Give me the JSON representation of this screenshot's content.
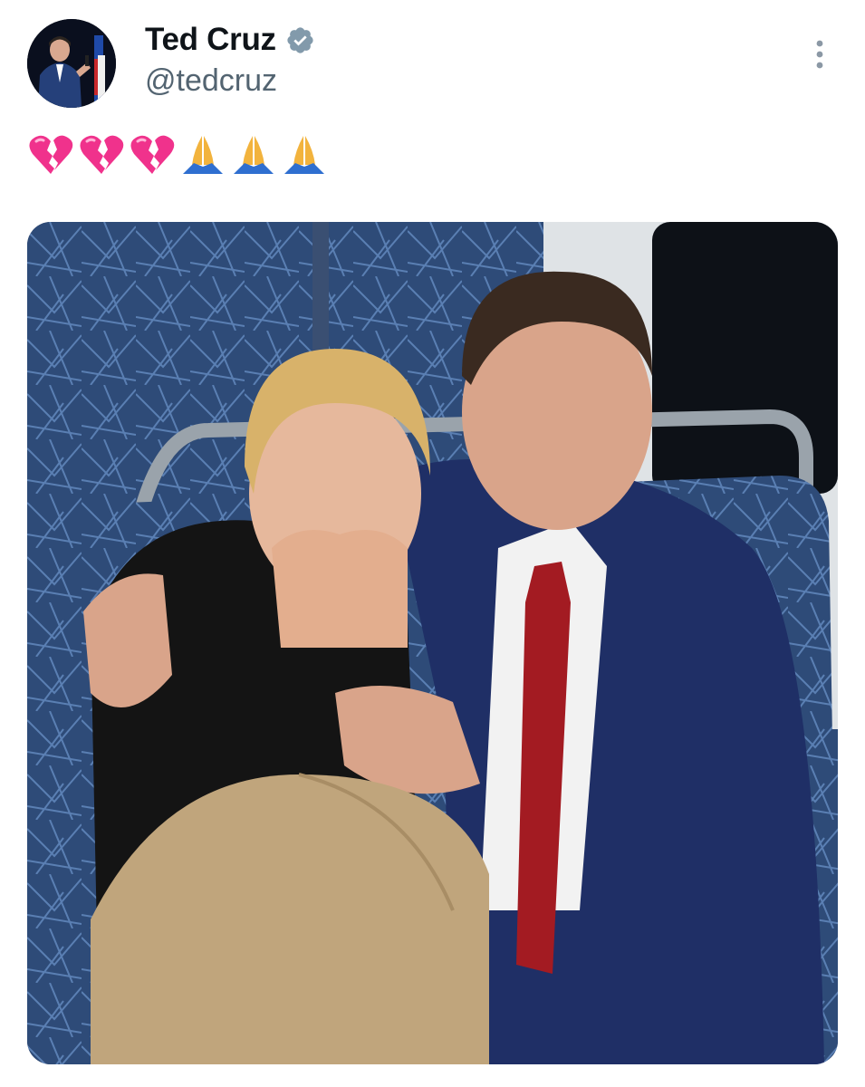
{
  "tweet": {
    "author_name": "Ted Cruz",
    "author_handle": "@tedcruz",
    "verified": true,
    "text_emojis": [
      "broken-heart",
      "broken-heart",
      "broken-heart",
      "folded-hands",
      "folded-hands",
      "folded-hands"
    ]
  },
  "colors": {
    "name": "#0f1419",
    "handle": "#536471",
    "verified_badge": "#829aab",
    "broken_heart": "#f0328c",
    "folded_hands": "#f2b33d"
  },
  "icons": {
    "more": "more-vertical-icon",
    "verified": "verified-badge-icon"
  }
}
